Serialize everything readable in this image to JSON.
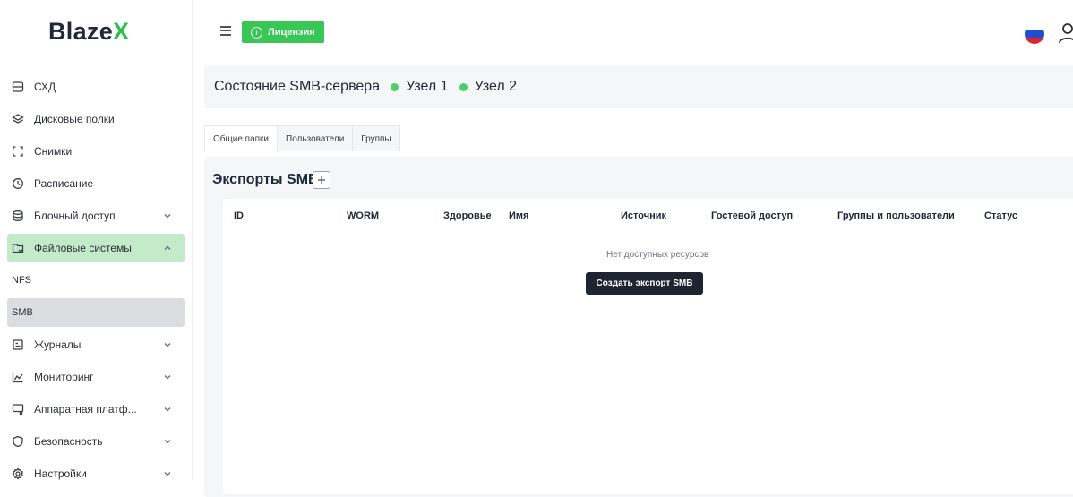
{
  "logo": {
    "part1": "Blaze",
    "part2": "X"
  },
  "sidebar": {
    "items": [
      {
        "label": "СХД",
        "icon": "storage-icon"
      },
      {
        "label": "Дисковые полки",
        "icon": "layers-icon"
      },
      {
        "label": "Снимки",
        "icon": "snapshot-icon"
      },
      {
        "label": "Расписание",
        "icon": "clock-icon"
      },
      {
        "label": "Блочный доступ",
        "icon": "database-icon"
      },
      {
        "label": "Файловые системы",
        "icon": "folder-icon"
      },
      {
        "label": "Журналы",
        "icon": "log-icon"
      },
      {
        "label": "Мониторинг",
        "icon": "chart-icon"
      },
      {
        "label": "Аппаратная платф...",
        "icon": "hardware-icon"
      },
      {
        "label": "Безопасность",
        "icon": "shield-icon"
      },
      {
        "label": "Настройки",
        "icon": "gear-icon"
      }
    ],
    "subitems": [
      {
        "label": "NFS"
      },
      {
        "label": "SMB"
      }
    ]
  },
  "topbar": {
    "license_label": "Лицензия"
  },
  "status": {
    "title": "Состояние SMB-сервера",
    "nodes": [
      {
        "label": "Узел 1"
      },
      {
        "label": "Узел 2"
      }
    ]
  },
  "tabs": [
    {
      "label": "Общие папки"
    },
    {
      "label": "Пользователи"
    },
    {
      "label": "Группы"
    }
  ],
  "exports": {
    "title": "Экспорты SMB",
    "columns": [
      "ID",
      "WORM",
      "Здоровье",
      "Имя",
      "Источник",
      "Гостевой доступ",
      "Группы и пользователи",
      "Статус"
    ],
    "empty_text": "Нет доступных ресурсов",
    "create_label": "Создать экспорт SMB"
  },
  "colors": {
    "accent": "#38c755",
    "active_bg": "#c3ebc9",
    "dark_button": "#1e2530"
  }
}
